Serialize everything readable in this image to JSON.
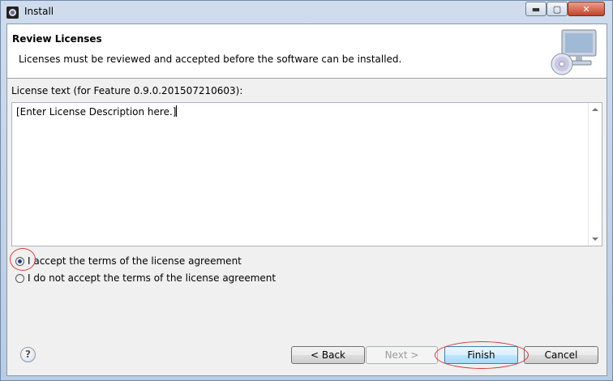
{
  "window": {
    "title": "Install",
    "minimize_glyph": "▬",
    "maximize_glyph": "▢",
    "close_glyph": "✕"
  },
  "banner": {
    "title": "Review Licenses",
    "description": "Licenses must be reviewed and accepted before the software can be installed.",
    "image_icon": "computer-disc-icon"
  },
  "license": {
    "label": "License text (for Feature 0.9.0.201507210603):",
    "text": "[Enter License Description here.]"
  },
  "options": {
    "accept_label": "I accept the terms of the license agreement",
    "decline_label": "I do not accept the terms of the license agreement",
    "selected": "accept"
  },
  "footer": {
    "help_glyph": "?",
    "back_label": "< Back",
    "next_label": "Next >",
    "finish_label": "Finish",
    "cancel_label": "Cancel"
  },
  "annotations": {
    "color": "#d23c3c"
  }
}
